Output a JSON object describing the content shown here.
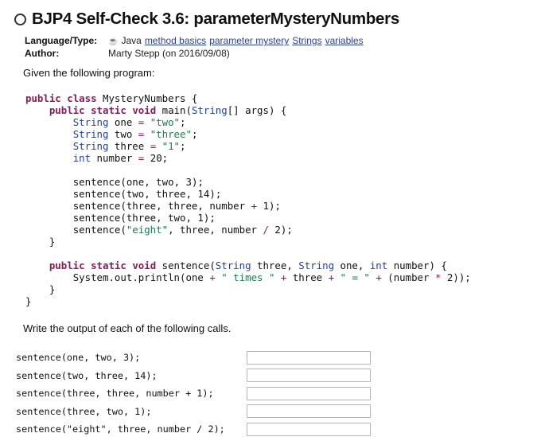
{
  "problem": {
    "title": "BJP4 Self-Check 3.6: parameterMysteryNumbers",
    "language_label": "Language/Type:",
    "language": "Java",
    "tags": [
      "method basics",
      "parameter mystery",
      "Strings",
      "variables"
    ],
    "author_label": "Author:",
    "author": "Marty Stepp (on 2016/09/08)",
    "intro": "Given the following program:",
    "instructions": "Write the output of each of the following calls."
  },
  "code": {
    "lines": [
      "public class MysteryNumbers {",
      "    public static void main(String[] args) {",
      "        String one = \"two\";",
      "        String two = \"three\";",
      "        String three = \"1\";",
      "        int number = 20;",
      "",
      "        sentence(one, two, 3);",
      "        sentence(two, three, 14);",
      "        sentence(three, three, number + 1);",
      "        sentence(three, two, 1);",
      "        sentence(\"eight\", three, number / 2);",
      "    }",
      "",
      "    public static void sentence(String three, String one, int number) {",
      "        System.out.println(one + \" times \" + three + \" = \" + (number * 2));",
      "    }",
      "}"
    ]
  },
  "calls": [
    {
      "text": "sentence(one, two, 3);",
      "answer": ""
    },
    {
      "text": "sentence(two, three, 14);",
      "answer": ""
    },
    {
      "text": "sentence(three, three, number + 1);",
      "answer": ""
    },
    {
      "text": "sentence(three, two, 1);",
      "answer": ""
    },
    {
      "text": "sentence(\"eight\", three, number / 2);",
      "answer": ""
    }
  ],
  "icons": {
    "status": "circle-outline-icon",
    "language": "java-cup-icon"
  }
}
